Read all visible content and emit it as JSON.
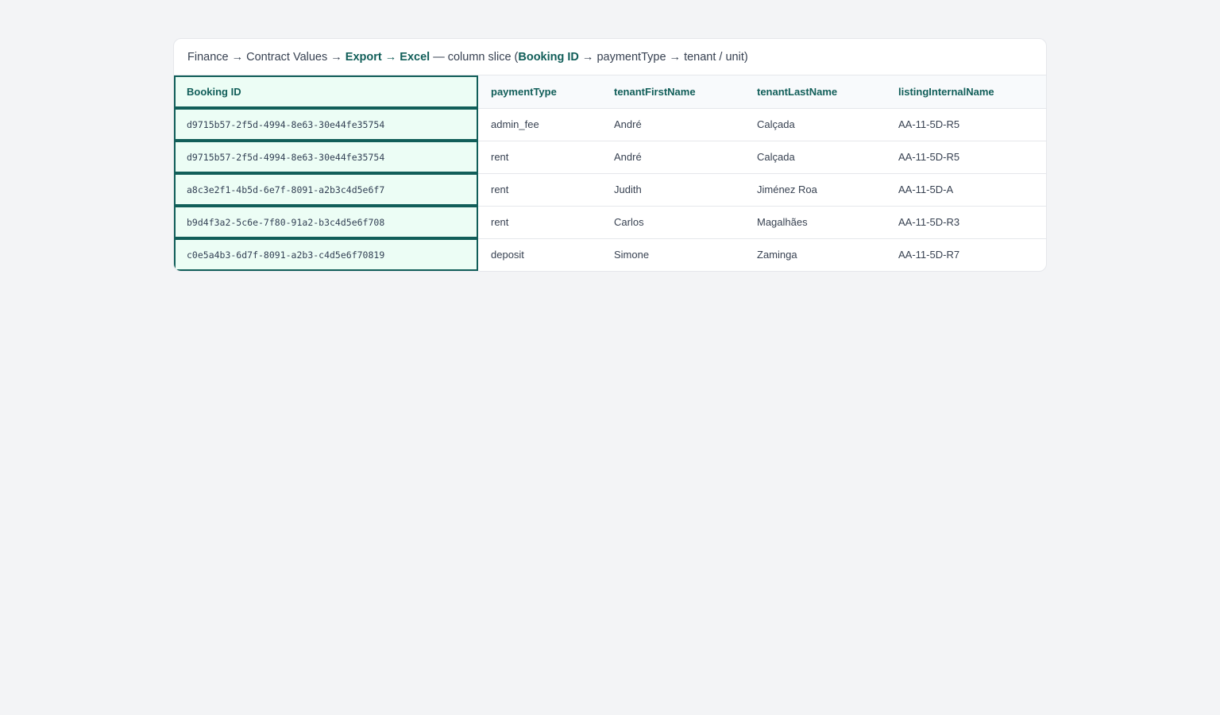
{
  "breadcrumb": {
    "part1": "Finance → Contract Values → ",
    "part2": "Export → Excel",
    "part3": " — column slice (",
    "part4": "Booking ID",
    "part5": " → paymentType → tenant / unit)"
  },
  "table": {
    "headers": [
      "Booking ID",
      "paymentType",
      "tenantFirstName",
      "tenantLastName",
      "listingInternalName"
    ],
    "rows": [
      [
        "d9715b57-2f5d-4994-8e63-30e44fe35754",
        "admin_fee",
        "André",
        "Calçada",
        "AA-11-5D-R5"
      ],
      [
        "d9715b57-2f5d-4994-8e63-30e44fe35754",
        "rent",
        "André",
        "Calçada",
        "AA-11-5D-R5"
      ],
      [
        "a8c3e2f1-4b5d-6e7f-8091-a2b3c4d5e6f7",
        "rent",
        "Judith",
        "Jiménez Roa",
        "AA-11-5D-A"
      ],
      [
        "b9d4f3a2-5c6e-7f80-91a2-b3c4d5e6f708",
        "rent",
        "Carlos",
        "Magalhães",
        "AA-11-5D-R3"
      ],
      [
        "c0e5a4b3-6d7f-8091-a2b3-c4d5e6f70819",
        "deposit",
        "Simone",
        "Zaminga",
        "AA-11-5D-R7"
      ]
    ],
    "highlighted_column": "Booking ID"
  },
  "colors": {
    "accent": "#115e59",
    "highlight_bg": "#ecfdf5",
    "page_bg": "#f3f4f6"
  }
}
